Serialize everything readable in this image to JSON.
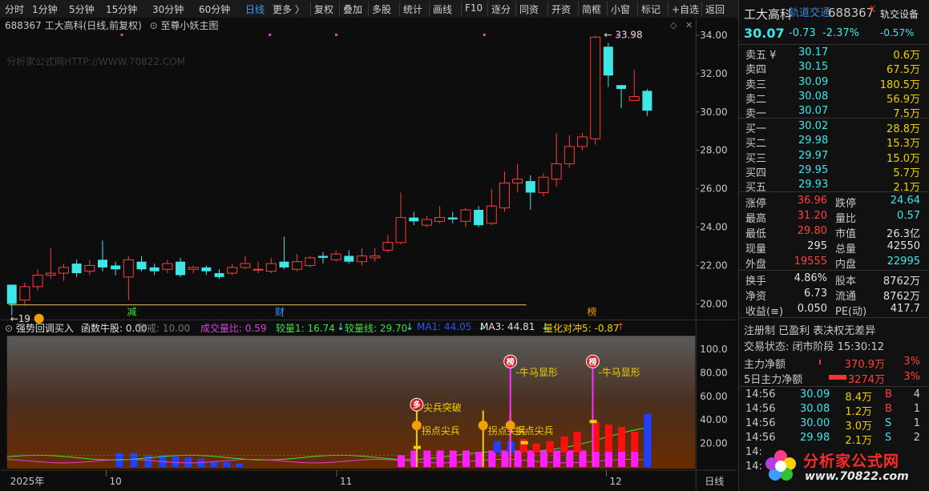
{
  "toolbar": {
    "left_items": [
      "分时",
      "1分钟",
      "5分钟",
      "15分钟",
      "30分钟",
      "60分钟",
      "日线",
      "更多 〉"
    ],
    "right_items": [
      "复权",
      "叠加",
      "多股",
      "统计",
      "画线",
      "F10",
      "逐分",
      "同资",
      "开资",
      "简框",
      "小窗",
      "标记",
      "+自选",
      "返回"
    ],
    "active": "日线"
  },
  "chart_header": {
    "code_name": "688367  工大高科(日线,前复权)",
    "template": "至尊小妖主图"
  },
  "watermark": "分析家公式网HTTP://WWW.70822.COM",
  "price_axis": [
    "34.00",
    "32.00",
    "30.00",
    "28.00",
    "26.00",
    "24.00",
    "22.00",
    "20.00"
  ],
  "price_labels": {
    "high": "33.98",
    "low": "19"
  },
  "date_axis": [
    "2025年",
    "10",
    "11",
    "12"
  ],
  "date_axis_right": "日线",
  "markers": {
    "jian": "减",
    "cai": "财",
    "bang": "榜"
  },
  "indicator_header": {
    "name": "强势回调买入",
    "items": [
      {
        "label": "函数牛股: 0.00",
        "color": "#e0e0e0"
      },
      {
        "label": "警戒: 10.00",
        "color": "#777777"
      },
      {
        "label": "成交量比: 0.59",
        "color": "#e040e0"
      },
      {
        "label": "较量1: 16.74",
        "color": "#40e040"
      },
      {
        "label": "较量线: 29.70",
        "color": "#40e040"
      },
      {
        "label": "MA1: 44.05",
        "color": "#3050ff"
      },
      {
        "label": "MA3: 44.81",
        "color": "#e0e0e0"
      },
      {
        "label": "量化对冲5: -0.87",
        "color": "#f0d000"
      }
    ]
  },
  "indicator_axis": [
    "100.0",
    "80.00",
    "60.00",
    "40.00",
    "20.00"
  ],
  "signals": {
    "niuma": "-牛马显形",
    "jianbing": "尖兵突破",
    "guaidian": "拐点尖兵",
    "bang_icon": "榜",
    "duo_icon": "多"
  },
  "quote": {
    "name": "工大高科",
    "overlay": "轨道交通",
    "code": "688367",
    "tag": "K",
    "right_tag": "轨交设备",
    "price": "30.07",
    "change": "-0.73",
    "change_pct": "-2.37%",
    "sector_pct": "-0.57%"
  },
  "asks": [
    {
      "label": "卖五 ¥",
      "price": "30.17",
      "vol": "0.6万"
    },
    {
      "label": "卖四",
      "price": "30.15",
      "vol": "67.5万"
    },
    {
      "label": "卖三",
      "price": "30.09",
      "vol": "180.5万"
    },
    {
      "label": "卖二",
      "price": "30.08",
      "vol": "56.9万"
    },
    {
      "label": "卖一",
      "price": "30.07",
      "vol": "7.5万"
    }
  ],
  "bids": [
    {
      "label": "买一",
      "price": "30.02",
      "vol": "28.8万"
    },
    {
      "label": "买二",
      "price": "29.98",
      "vol": "15.3万"
    },
    {
      "label": "买三",
      "price": "29.97",
      "vol": "15.0万"
    },
    {
      "label": "买四",
      "price": "29.95",
      "vol": "5.7万"
    },
    {
      "label": "买五",
      "price": "29.93",
      "vol": "2.1万"
    }
  ],
  "stats": [
    [
      {
        "l": "涨停",
        "v": "36.96",
        "c": "red"
      },
      {
        "l": "跌停",
        "v": "24.64",
        "c": "grn"
      }
    ],
    [
      {
        "l": "最高",
        "v": "31.20",
        "c": "red"
      },
      {
        "l": "量比",
        "v": "0.57",
        "c": "grn"
      }
    ],
    [
      {
        "l": "最低",
        "v": "29.80",
        "c": "red"
      },
      {
        "l": "市值",
        "v": "26.3亿",
        "c": "wht"
      }
    ],
    [
      {
        "l": "现量",
        "v": "295",
        "c": "wht"
      },
      {
        "l": "总量",
        "v": "42550",
        "c": "wht"
      }
    ],
    [
      {
        "l": "外盘",
        "v": "19555",
        "c": "red"
      },
      {
        "l": "内盘",
        "v": "22995",
        "c": "grn"
      }
    ]
  ],
  "stats2": [
    [
      {
        "l": "换手",
        "v": "4.86%",
        "c": "wht"
      },
      {
        "l": "股本",
        "v": "8762万",
        "c": "wht"
      }
    ],
    [
      {
        "l": "净资",
        "v": "6.73",
        "c": "wht"
      },
      {
        "l": "流通",
        "v": "8762万",
        "c": "wht"
      }
    ],
    [
      {
        "l": "收益(≡)",
        "v": "0.050",
        "c": "wht"
      },
      {
        "l": "PE(动)",
        "v": "417.7",
        "c": "wht"
      }
    ]
  ],
  "reg_line": "注册制 已盈利 表决权无差异",
  "trade_status": "交易状态: 闭市阶段 15:30:12",
  "net_flow": [
    {
      "label": "主力净额",
      "value": "370.9万",
      "pct": "3%"
    },
    {
      "label": "5日主力净额",
      "value": "3274万",
      "pct": "3%"
    }
  ],
  "ticks": [
    {
      "time": "14:56",
      "price": "30.09",
      "vol": "8.4万",
      "side": "B",
      "n": "4"
    },
    {
      "time": "14:56",
      "price": "30.08",
      "vol": "1.2万",
      "side": "B",
      "n": "1"
    },
    {
      "time": "14:56",
      "price": "30.00",
      "vol": "3.0万",
      "side": "S",
      "n": "1"
    },
    {
      "time": "14:56",
      "price": "29.98",
      "vol": "2.1万",
      "side": "S",
      "n": "2"
    },
    {
      "time": "14:",
      "price": "",
      "vol": "",
      "side": "",
      "n": ""
    },
    {
      "time": "14:",
      "price": "",
      "vol": "",
      "side": "",
      "n": ""
    }
  ],
  "brand": {
    "name": "分析家公式网",
    "url": "www.70822.com"
  },
  "candles": [
    [
      21.0,
      20.0,
      20.5,
      19.4
    ],
    [
      20.2,
      20.9,
      21.1,
      19.9
    ],
    [
      20.9,
      21.5,
      21.8,
      20.7
    ],
    [
      21.5,
      21.6,
      22.9,
      21.3
    ],
    [
      21.6,
      21.9,
      22.1,
      21.2
    ],
    [
      22.1,
      21.6,
      22.3,
      21.4
    ],
    [
      21.7,
      22.0,
      22.3,
      21.5
    ],
    [
      22.3,
      21.9,
      23.3,
      21.7
    ],
    [
      22.0,
      21.8,
      22.2,
      21.5
    ],
    [
      21.4,
      22.3,
      22.5,
      20.2
    ],
    [
      22.2,
      21.8,
      22.5,
      21.7
    ],
    [
      21.9,
      21.7,
      22.1,
      21.5
    ],
    [
      21.8,
      22.1,
      22.3,
      21.6
    ],
    [
      22.2,
      21.5,
      22.4,
      21.4
    ],
    [
      21.8,
      21.9,
      22.0,
      21.6
    ],
    [
      21.9,
      21.7,
      22.0,
      21.5
    ],
    [
      21.6,
      21.4,
      21.8,
      21.3
    ],
    [
      21.6,
      21.9,
      22.1,
      21.5
    ],
    [
      21.9,
      22.1,
      22.5,
      21.8
    ],
    [
      21.8,
      21.8,
      22.2,
      21.6
    ],
    [
      21.7,
      22.1,
      22.4,
      21.6
    ],
    [
      22.2,
      21.9,
      23.5,
      21.8
    ],
    [
      21.8,
      22.2,
      22.6,
      21.7
    ],
    [
      22.0,
      22.4,
      22.5,
      21.9
    ],
    [
      22.5,
      22.4,
      22.7,
      22.1
    ],
    [
      22.3,
      22.6,
      22.8,
      22.2
    ],
    [
      22.5,
      22.2,
      22.8,
      22.1
    ],
    [
      22.2,
      22.5,
      22.9,
      22.0
    ],
    [
      22.4,
      22.5,
      22.9,
      22.2
    ],
    [
      22.8,
      23.2,
      23.6,
      22.7
    ],
    [
      23.2,
      24.5,
      25.8,
      23.1
    ],
    [
      24.5,
      24.3,
      24.8,
      24.1
    ],
    [
      24.1,
      24.4,
      24.6,
      24.0
    ],
    [
      24.3,
      24.5,
      25.1,
      24.2
    ],
    [
      24.5,
      24.4,
      24.8,
      24.2
    ],
    [
      24.3,
      24.9,
      25.0,
      24.0
    ],
    [
      24.9,
      24.1,
      25.1,
      24.0
    ],
    [
      24.2,
      25.1,
      26.0,
      24.1
    ],
    [
      25.0,
      26.3,
      26.9,
      24.8
    ],
    [
      26.3,
      26.5,
      27.3,
      25.8
    ],
    [
      26.4,
      25.8,
      26.7,
      24.9
    ],
    [
      25.8,
      26.6,
      26.8,
      25.6
    ],
    [
      26.5,
      27.3,
      28.9,
      26.1
    ],
    [
      27.3,
      28.2,
      28.8,
      27.1
    ],
    [
      28.2,
      28.7,
      28.9,
      28.0
    ],
    [
      28.6,
      33.9,
      33.98,
      28.3
    ],
    [
      33.4,
      31.9,
      33.6,
      31.3
    ],
    [
      31.4,
      31.2,
      31.4,
      30.2
    ],
    [
      30.6,
      30.8,
      32.2,
      30.6
    ],
    [
      31.1,
      30.07,
      31.2,
      29.8
    ]
  ],
  "vol_bars": [
    [
      0,
      0,
      "n"
    ],
    [
      0,
      0,
      "n"
    ],
    [
      0,
      0,
      "n"
    ],
    [
      0,
      0,
      "n"
    ],
    [
      0,
      0,
      "n"
    ],
    [
      0,
      0,
      "n"
    ],
    [
      0,
      0,
      "n"
    ],
    [
      0,
      0,
      "n"
    ],
    [
      0,
      0,
      "n"
    ],
    [
      0,
      0,
      "n"
    ],
    [
      0,
      0,
      "n"
    ],
    [
      0,
      0,
      "n"
    ],
    [
      0,
      0,
      "n"
    ],
    [
      0,
      0,
      "n"
    ],
    [
      0,
      0,
      "n"
    ],
    [
      0,
      0,
      "n"
    ],
    [
      0,
      0,
      "n"
    ],
    [
      0,
      0,
      "n"
    ],
    [
      0,
      0,
      "n"
    ],
    [
      0,
      0,
      "n"
    ],
    [
      0,
      0,
      "n"
    ],
    [
      0,
      0,
      "n"
    ],
    [
      0,
      0,
      "n"
    ],
    [
      0,
      0,
      "n"
    ],
    [
      0,
      0,
      "n"
    ],
    [
      0,
      0,
      "n"
    ],
    [
      0,
      0,
      "n"
    ],
    [
      0,
      0,
      "n"
    ],
    [
      0,
      0,
      "n"
    ],
    [
      0,
      0,
      "n"
    ],
    [
      10,
      0,
      "m"
    ],
    [
      14,
      0,
      "m"
    ],
    [
      14,
      0,
      "m"
    ],
    [
      14,
      0,
      "m"
    ],
    [
      14,
      0,
      "m"
    ],
    [
      14,
      0,
      "m"
    ],
    [
      13,
      0,
      "m"
    ],
    [
      14,
      0,
      "m"
    ],
    [
      14,
      0,
      "m"
    ],
    [
      14,
      0,
      "m"
    ],
    [
      14,
      0,
      "m"
    ],
    [
      14,
      0,
      "m"
    ],
    [
      14,
      0,
      "m"
    ],
    [
      14,
      0,
      "m"
    ],
    [
      14,
      0,
      "m"
    ],
    [
      13,
      38,
      "r"
    ],
    [
      13,
      36,
      "r"
    ],
    [
      13,
      34,
      "r"
    ],
    [
      13,
      30,
      "r"
    ],
    [
      0,
      45,
      "b"
    ]
  ]
}
